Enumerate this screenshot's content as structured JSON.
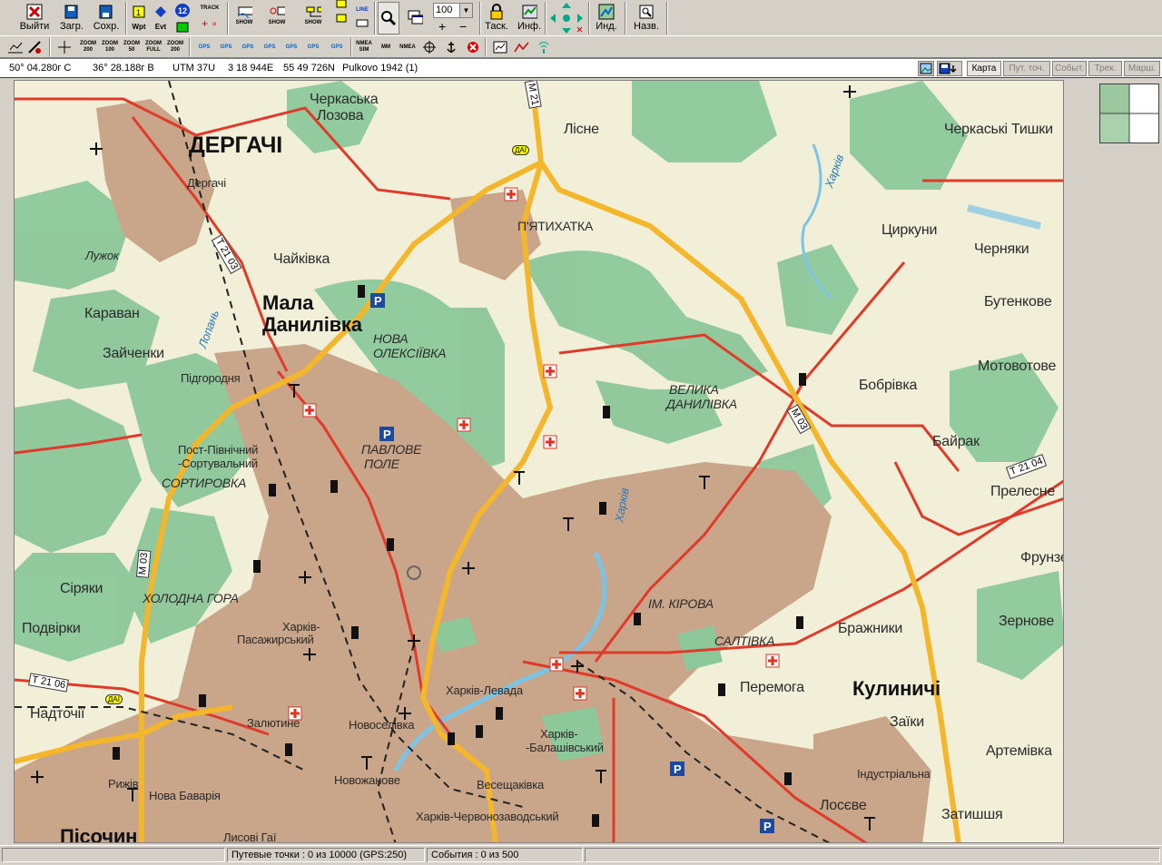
{
  "toolbar": {
    "exit": "Выйти",
    "load": "Загр.",
    "save": "Сохр.",
    "wpt": "Wpt",
    "evt": "Evt",
    "num12": "12",
    "track": "TRACK",
    "show1": "SHOW",
    "show2": "SHOW",
    "show3": "SHOW",
    "line": "LINE",
    "zoom_value": "100",
    "task": "Таск.",
    "info": "Инф.",
    "ind": "Инд.",
    "names": "Назв."
  },
  "toolbar2": {
    "z200": "ZOOM 200",
    "z100": "ZOOM 100",
    "z50": "ZOOM 50",
    "zfull": "ZOOM FULL",
    "z200b": "ZOOM 200",
    "gps": "GPS",
    "nmea_sim": "NMEA SIM",
    "mm": "MM",
    "nmea": "NMEA"
  },
  "coords": {
    "lat": "50° 04.280г С",
    "lon": "36° 28.188г В",
    "utm": "UTM  37U",
    "easting": "3 18 944E",
    "northing": "55 49 726N",
    "datum": "Pulkovo 1942 (1)"
  },
  "tabs": [
    "Карта",
    "Пут. точ.",
    "Событ.",
    "Трек.",
    "Марш."
  ],
  "status": {
    "waypoints": "Путевые точки : 0 из 10000  (GPS:250)",
    "events": "События : 0 из 500"
  },
  "map": {
    "places": {
      "dergachi": "ДЕРГАЧІ",
      "dergachi_st": "Дергачі",
      "cherkaska1": "Черкаська",
      "cherkaska2": "Лозова",
      "lisne": "Лісне",
      "cherk_tyshky": "Черкаські Тишки",
      "kharkiv_r": "Харків",
      "tsyrkuny": "Циркуни",
      "chernyaky": "Черняки",
      "butenkove": "Бутенкове",
      "motovotove": "Мотовотове",
      "bobrivka": "Бобрівка",
      "bayrak": "Байрак",
      "prelesne": "Прелесне",
      "frunze": "Фрунзе",
      "zernove": "Зернове",
      "brazhnyky": "Бражники",
      "kulynychi": "Кулиничі",
      "zaiky": "Заїки",
      "artemivka": "Артемівка",
      "industrialna": "Індустріальна",
      "losieve": "Лосєве",
      "zatyshshya": "Затишшя",
      "pyatykhatka": "П'ЯТИХАТКА",
      "luzhok": "Лужок",
      "chaikivka": "Чайківка",
      "mala1": "Мала",
      "mala2": "Данилівка",
      "karavan": "Караван",
      "zaichenky": "Зайченки",
      "lopan": "Лопань",
      "pidgorodnya": "Підгородня",
      "nova1": "НОВА",
      "nova2": "ОЛЕКСІЇВКА",
      "velyka1": "ВЕЛИКА",
      "velyka2": "ДАНИЛІВКА",
      "pavlove1": "ПАВЛОВЕ",
      "pavlove2": "ПОЛЕ",
      "post1": "Пост-Північний",
      "post2": "-Сортувальний",
      "sortyrovka": "СОРТИРОВКА",
      "kharkiv_r2": "Харків",
      "siryaky": "Сіряки",
      "kholodna": "ХОЛОДНА ГОРА",
      "podvirky": "Подвірки",
      "kirova": "ІМ. КІРОВА",
      "saltivka": "САЛТІВКА",
      "kh_pas1": "Харків-",
      "kh_pas2": "Пасажирський",
      "nadtochii": "Надточії",
      "zalyutyne": "Залютине",
      "novoselivka": "Новоселівка",
      "kh_levada": "Харків-Левада",
      "kh_balash1": "Харків-",
      "kh_balash2": "-Балашівський",
      "peremoga": "Перемога",
      "ryzhiv": "Рижів",
      "nova_bavaria": "Нова Баварія",
      "novozhanove": "Новожанове",
      "veseshchakivka": "Весещаківка",
      "kh_chervono": "Харків-Червонозаводський",
      "lisochyn": "Пісочин",
      "lysovi_gai": "Лисові Гаї",
      "m21": "М 21",
      "t2103": "Т 21 03",
      "m03a": "М 03",
      "m03b": "М 03",
      "t2104": "Т 21 04",
      "t2106": "Т 21 06",
      "dai1": "ДАІ",
      "dai2": "ДАІ"
    }
  }
}
